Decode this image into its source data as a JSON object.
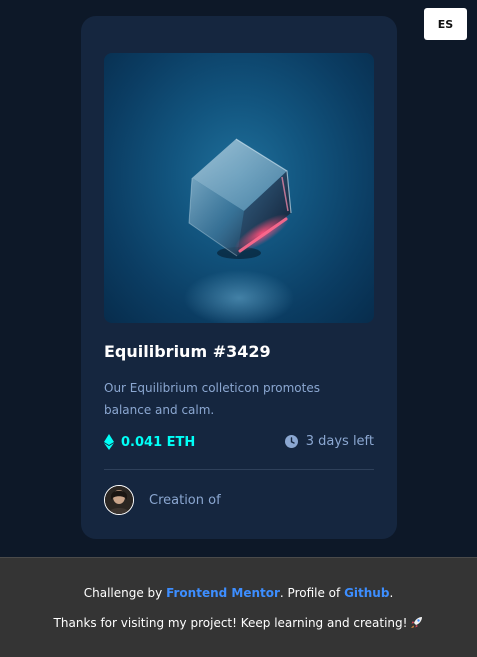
{
  "language_button": {
    "label": "ES"
  },
  "card": {
    "title": "Equilibrium #3429",
    "description": "Our Equilibrium colleticon promotes balance and calm.",
    "price": "0.041 ETH",
    "time_left": "3 days left",
    "creator_text": "Creation of",
    "image_icon": "crystal-cube-image",
    "price_icon": "ethereum-icon",
    "time_icon": "clock-icon"
  },
  "footer": {
    "line1_prefix": "Challenge by ",
    "line1_link1": "Frontend Mentor",
    "line1_middle": ". Profile of ",
    "line1_link2": "Github",
    "line1_suffix": ".",
    "line2_text": "Thanks for visiting my project! Keep learning and creating!",
    "line2_icon": "rocket-icon"
  },
  "colors": {
    "page_background": "#0d1828",
    "card_background": "#15263f",
    "accent_cyan": "#00fff7",
    "soft_blue": "#8ba7d1",
    "link_blue": "#3d8eff",
    "footer_background": "#343434"
  }
}
